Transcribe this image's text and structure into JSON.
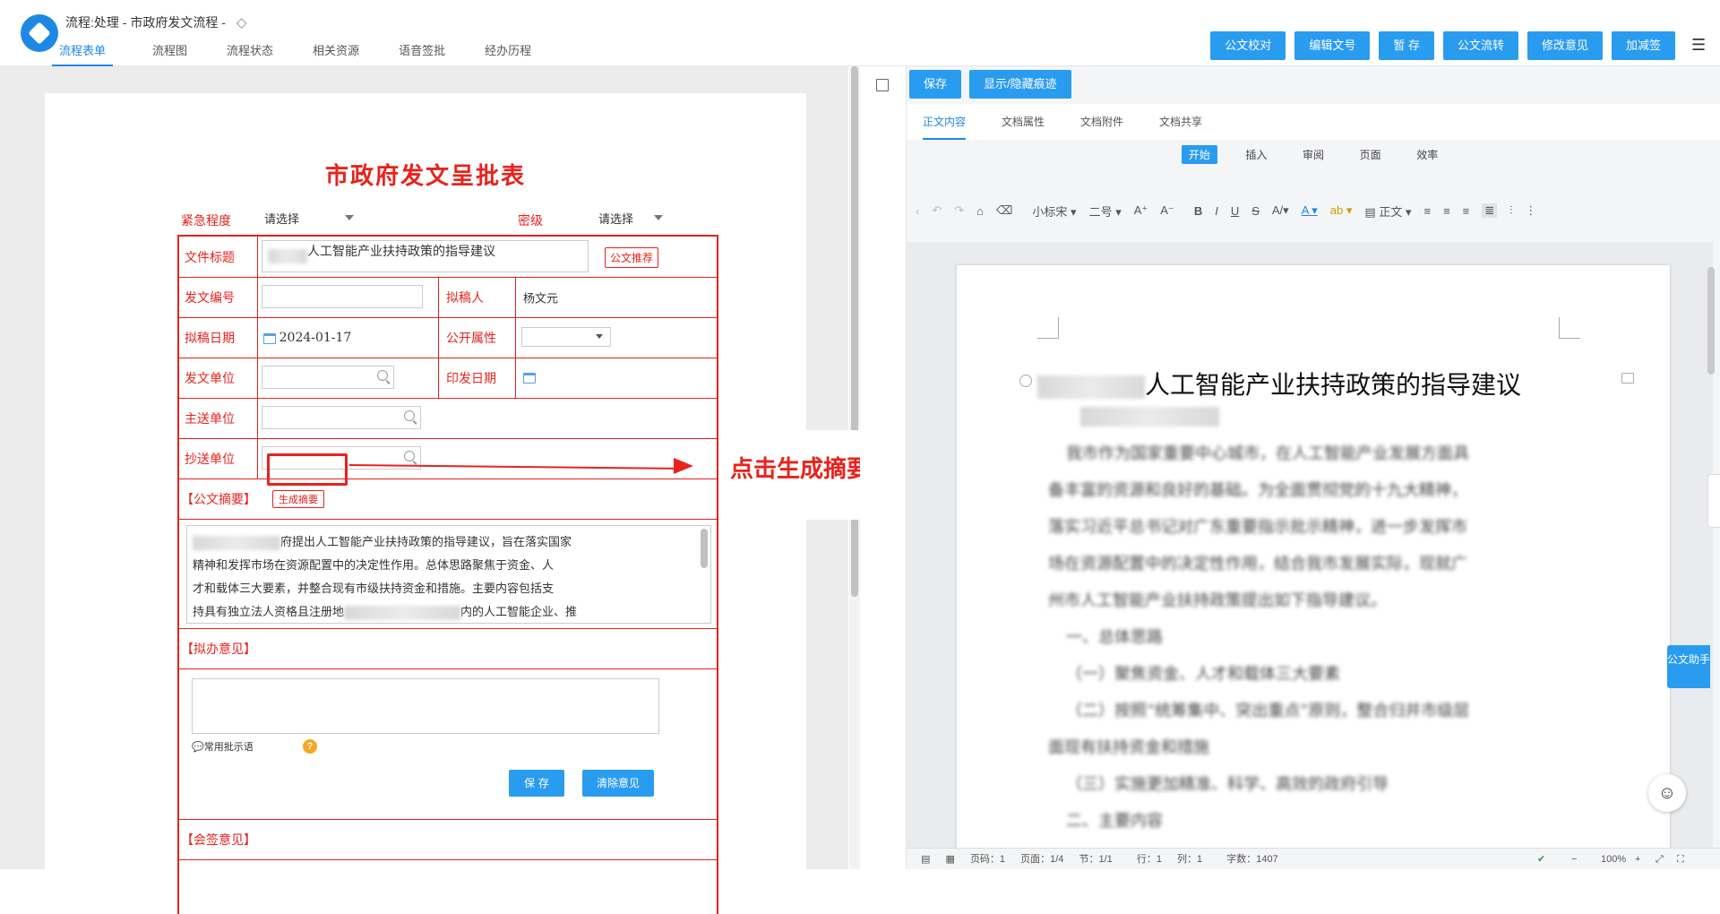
{
  "header": {
    "title": "流程:处理 - 市政府发文流程 -",
    "tabs": [
      "流程表单",
      "流程图",
      "流程状态",
      "相关资源",
      "语音签批",
      "经办历程"
    ],
    "buttons": [
      "公文校对",
      "编辑文号",
      "暂 存",
      "公文流转",
      "修改意见",
      "加减签"
    ]
  },
  "form": {
    "title": "市政府发文呈批表",
    "urgency_label": "紧急程度",
    "urgency_value": "请选择",
    "secret_label": "密级",
    "secret_value": "请选择",
    "doc_title_label": "文件标题",
    "doc_title_value": "人工智能产业扶持政策的指导建议",
    "recommend_btn": "公文推荐",
    "doc_no_label": "发文编号",
    "drafter_label": "拟稿人",
    "drafter_value": "杨文元",
    "draft_date_label": "拟稿日期",
    "draft_date_value": "2024-01-17",
    "public_label": "公开属性",
    "issuer_label": "发文单位",
    "print_date_label": "印发日期",
    "main_send_label": "主送单位",
    "cc_label": "抄送单位",
    "summary_label": "【公文摘要】",
    "gen_summary_btn": "生成摘要",
    "summary_text_1": "府提出人工智能产业扶持政策的指导建议，旨在落实国家",
    "summary_text_2": "精神和发挥市场在资源配置中的决定性作用。总体思路聚焦于资金、人",
    "summary_text_3": "才和载体三大要素，并整合现有市级扶持资金和措施。主要内容包括支",
    "summary_text_4a": "持具有独立法人资格且注册地",
    "summary_text_4b": "内的人工智能企业、推",
    "opinion_label": "【拟办意见】",
    "common_phrase": "常用批示语",
    "save_btn": "保 存",
    "clear_btn": "清除意见",
    "countersign_label": "【会签意见】"
  },
  "annotation": {
    "text": "点击生成摘要"
  },
  "right": {
    "save_btn": "保存",
    "toggle_btn": "显示/隐藏痕迹",
    "tabs": [
      "正文内容",
      "文档属性",
      "文档附件",
      "文档共享"
    ],
    "ribbon_tabs": [
      "开始",
      "插入",
      "审阅",
      "页面",
      "效率"
    ],
    "font_name": "小标宋",
    "font_size": "二号",
    "style_name": "正文",
    "doc_title": "人工智能产业扶持政策的指导建议",
    "doc_lines": [
      "我市作为国家重要中心城市，在人工智能产业发展方面具",
      "备丰富的资源和良好的基础。为全面贯彻党的十九大精神，",
      "落实习近平总书记对广东重要指示批示精神，进一步发挥市",
      "场在资源配置中的决定性作用，结合我市发展实际，现就广",
      "州市人工智能产业扶持政策提出如下指导建议。",
      "一、总体思路",
      "（一）聚焦资金、人才和载体三大要素",
      "（二）按照“统筹集中、突出重点”原则，整合归并市级层",
      "面现有扶持资金和措施",
      "（三）实施更加精准、科学、高效的政府引导",
      "二、主要内容"
    ],
    "assistant": "公文助手",
    "status": [
      "页码：1",
      "页面：1/4",
      "节：1/1",
      "行：1",
      "列：1",
      "字数：1407"
    ],
    "zoom": "100%"
  }
}
